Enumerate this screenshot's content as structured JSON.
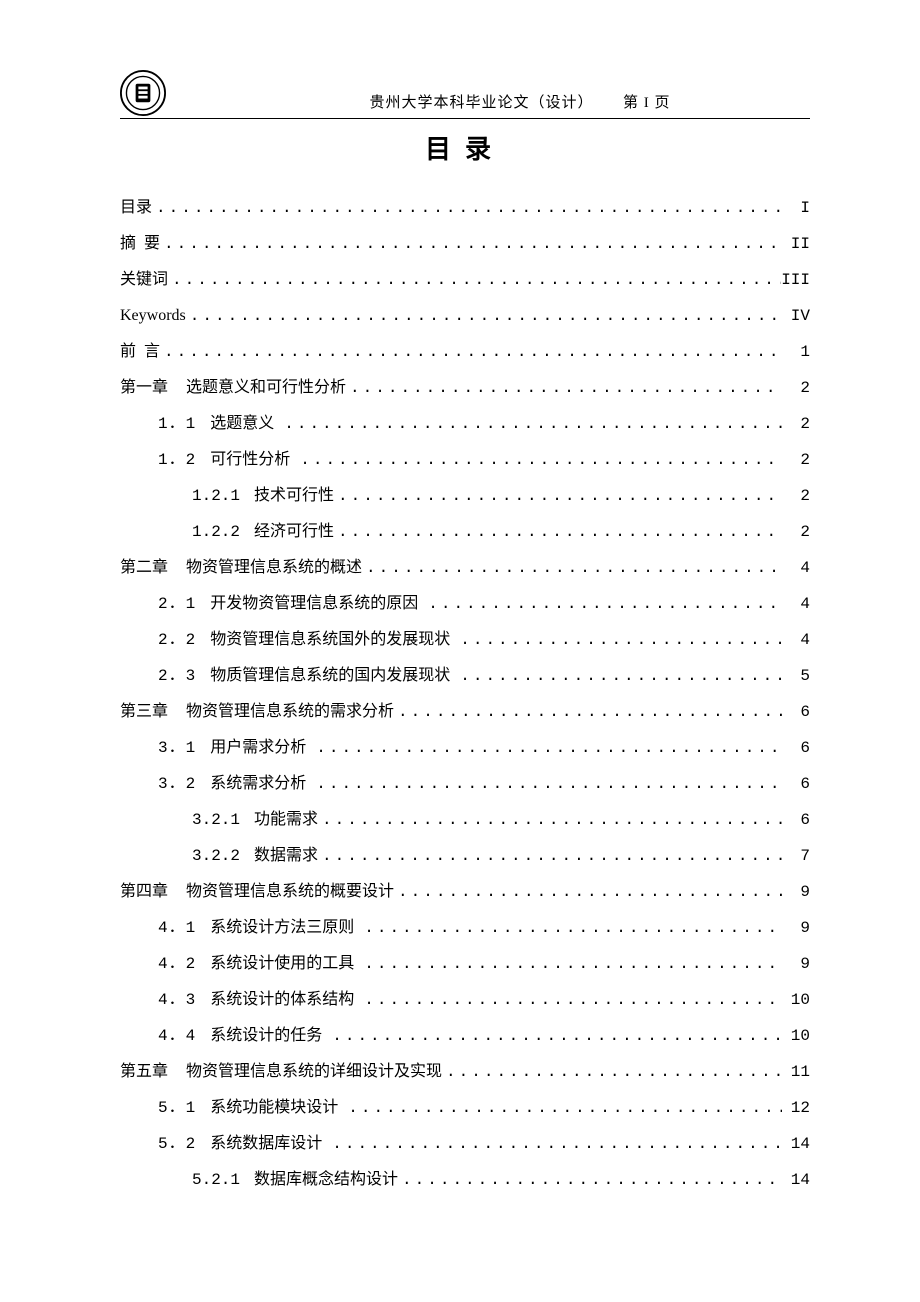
{
  "header": {
    "text_left": "贵州大学本科毕业论文（设计）",
    "text_right": "第 I 页"
  },
  "title": "目录",
  "toc": [
    {
      "level": 0,
      "num": "",
      "label": "目录",
      "page": "I"
    },
    {
      "level": 0,
      "num": "",
      "label": "摘  要",
      "page": "II"
    },
    {
      "level": 0,
      "num": "",
      "label": "关键词",
      "page": "III"
    },
    {
      "level": 0,
      "num": "",
      "label": "Keywords",
      "page": "IV"
    },
    {
      "level": 0,
      "num": "",
      "label": "前  言",
      "page": "1"
    },
    {
      "level": 0,
      "num": "第一章",
      "label": "选题意义和可行性分析",
      "page": "2"
    },
    {
      "level": 1,
      "num": "1．1",
      "label": "选题意义",
      "page": "2"
    },
    {
      "level": 1,
      "num": "1．2",
      "label": "可行性分析",
      "page": "2"
    },
    {
      "level": 2,
      "num": "1.2.1",
      "label": "技术可行性",
      "page": "2"
    },
    {
      "level": 2,
      "num": "1.2.2",
      "label": "经济可行性",
      "page": "2"
    },
    {
      "level": 0,
      "num": "第二章",
      "label": "物资管理信息系统的概述",
      "page": "4"
    },
    {
      "level": 1,
      "num": "2．1",
      "label": "开发物资管理信息系统的原因",
      "page": "4"
    },
    {
      "level": 1,
      "num": "2．2",
      "label": "物资管理信息系统国外的发展现状",
      "page": "4"
    },
    {
      "level": 1,
      "num": "2．3",
      "label": "物质管理信息系统的国内发展现状",
      "page": "5"
    },
    {
      "level": 0,
      "num": "第三章",
      "label": "物资管理信息系统的需求分析",
      "page": "6"
    },
    {
      "level": 1,
      "num": "3．1",
      "label": "用户需求分析",
      "page": "6"
    },
    {
      "level": 1,
      "num": "3．2",
      "label": "系统需求分析",
      "page": "6"
    },
    {
      "level": 2,
      "num": "3.2.1",
      "label": "功能需求",
      "page": "6"
    },
    {
      "level": 2,
      "num": "3.2.2",
      "label": "数据需求",
      "page": "7"
    },
    {
      "level": 0,
      "num": "第四章",
      "label": "物资管理信息系统的概要设计",
      "page": "9"
    },
    {
      "level": 1,
      "num": "4．1",
      "label": "系统设计方法三原则",
      "page": "9"
    },
    {
      "level": 1,
      "num": "4．2",
      "label": "系统设计使用的工具",
      "page": "9"
    },
    {
      "level": 1,
      "num": "4．3",
      "label": "系统设计的体系结构",
      "page": "10"
    },
    {
      "level": 1,
      "num": "4．4",
      "label": "系统设计的任务",
      "page": "10"
    },
    {
      "level": 0,
      "num": "第五章",
      "label": "物资管理信息系统的详细设计及实现",
      "page": "11"
    },
    {
      "level": 1,
      "num": "5．1",
      "label": "系统功能模块设计",
      "page": "12"
    },
    {
      "level": 1,
      "num": "5．2",
      "label": "系统数据库设计",
      "page": "14"
    },
    {
      "level": 2,
      "num": "5.2.1",
      "label": "数据库概念结构设计",
      "page": "14"
    }
  ]
}
